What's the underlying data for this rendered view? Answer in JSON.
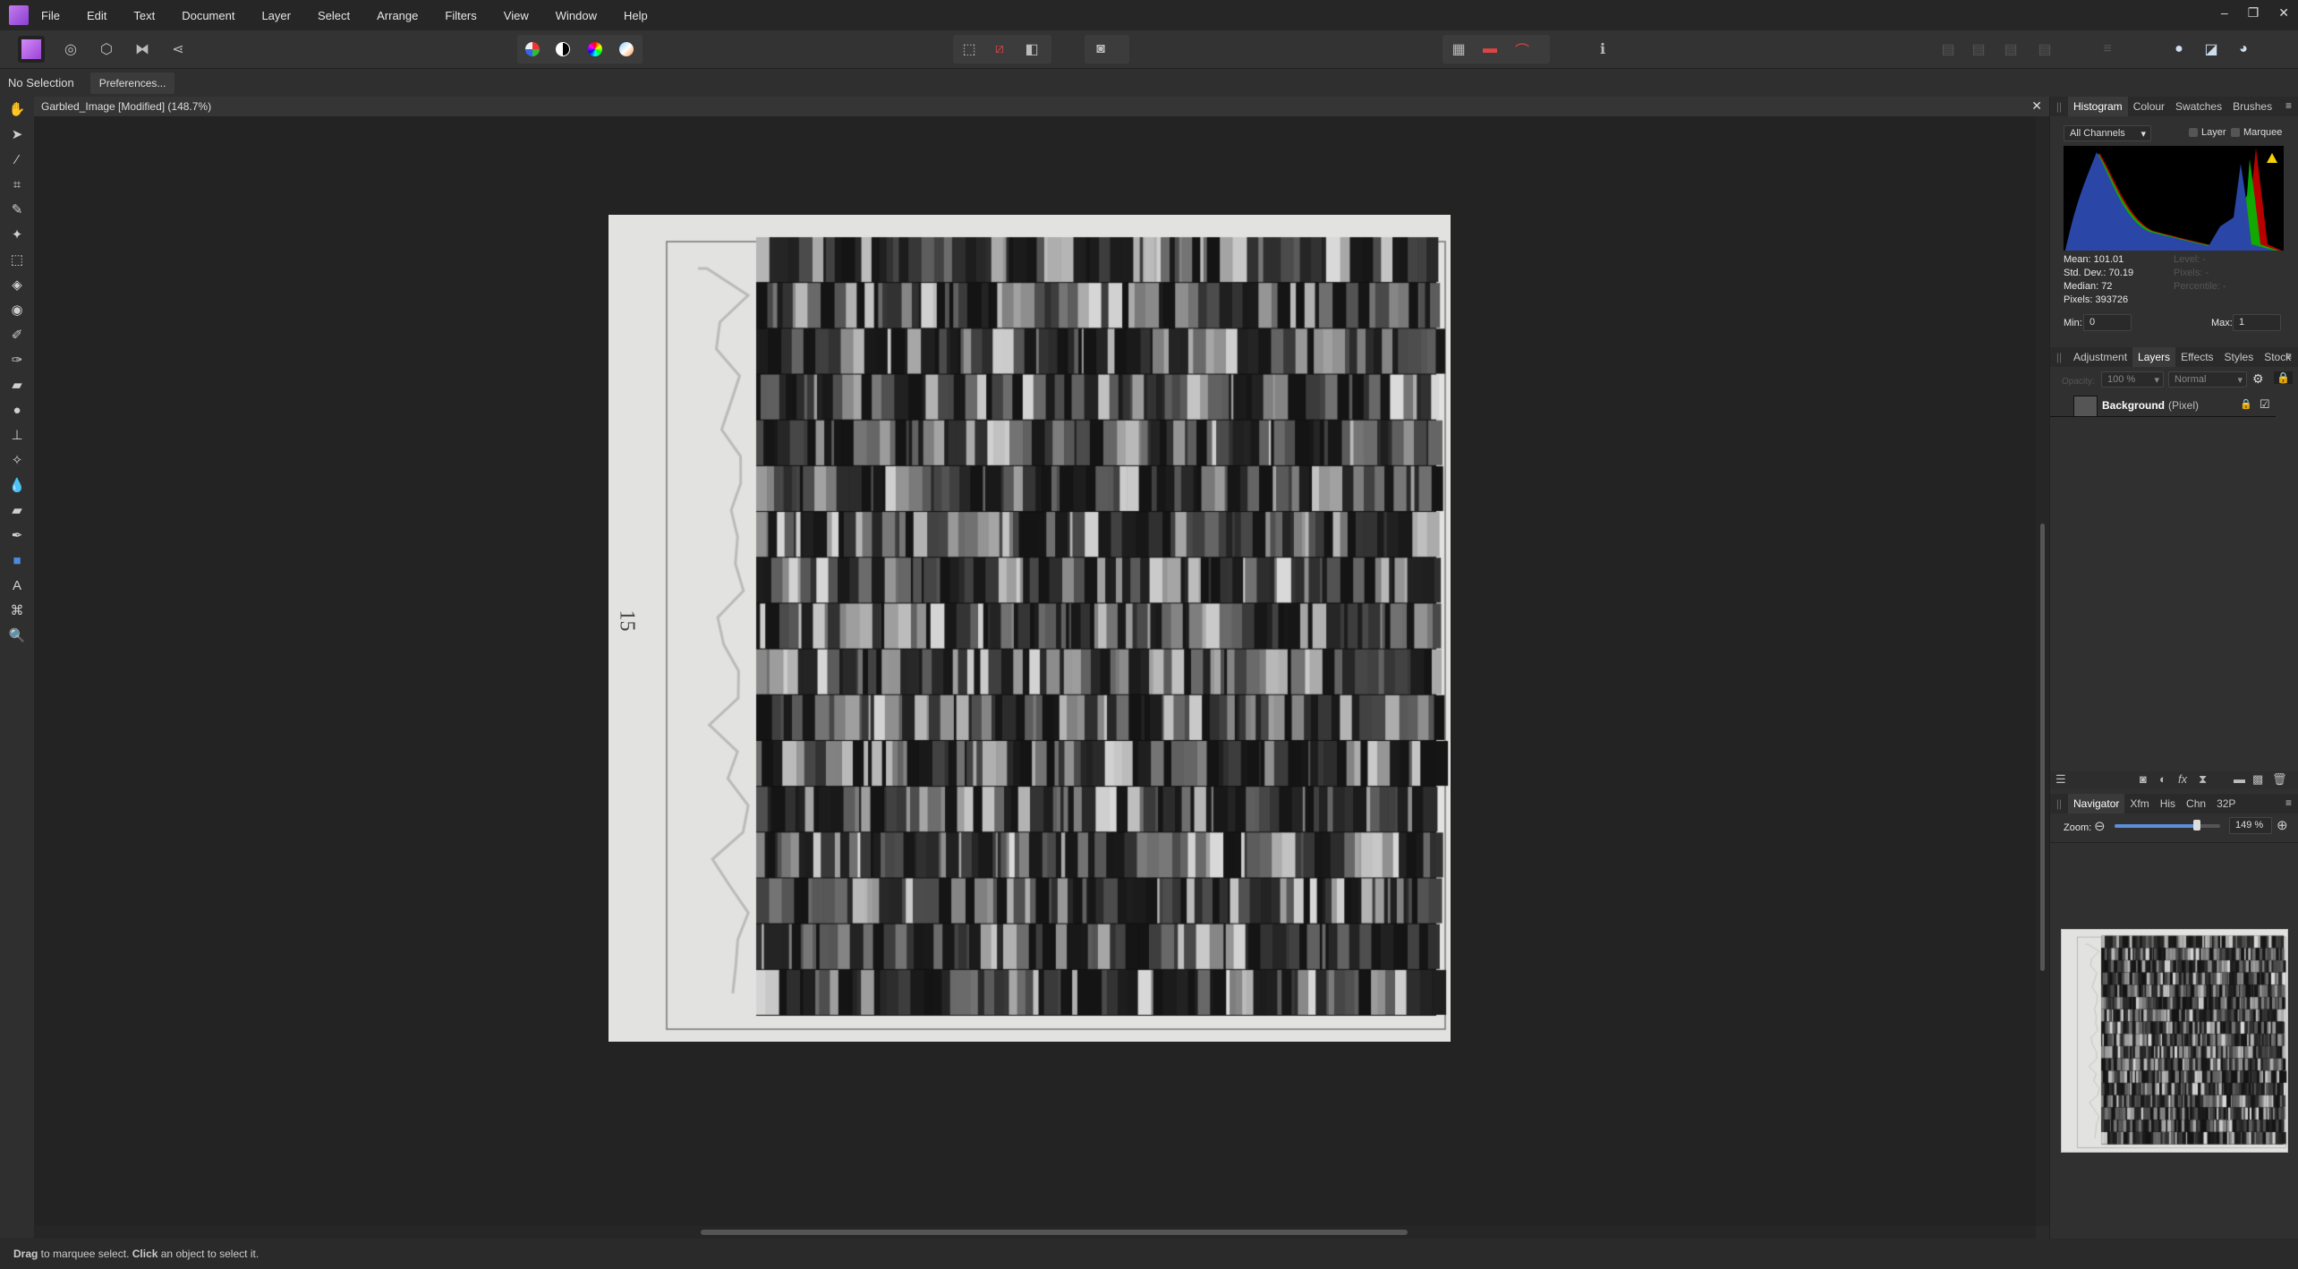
{
  "menu": {
    "items": [
      "File",
      "Edit",
      "Text",
      "Document",
      "Layer",
      "Select",
      "Arrange",
      "Filters",
      "View",
      "Window",
      "Help"
    ]
  },
  "window_controls": [
    "–",
    "❐",
    "✕"
  ],
  "context": {
    "selection": "No Selection",
    "preferences": "Preferences..."
  },
  "document": {
    "tab_title": "Garbled_Image [Modified] (148.7%)",
    "page_number": "15"
  },
  "histogram": {
    "tabs": [
      "Histogram",
      "Colour",
      "Swatches",
      "Brushes"
    ],
    "active_tab": "Histogram",
    "channel": "All Channels",
    "layer_label": "Layer",
    "marquee_label": "Marquee",
    "mean": "Mean: 101.01",
    "std": "Std. Dev.: 70.19",
    "median": "Median: 72",
    "pixels": "Pixels: 393726",
    "level": "Level: -",
    "pixels_hover": "Pixels: -",
    "percentile": "Percentile: -",
    "min_label": "Min:",
    "min": "0",
    "max_label": "Max:",
    "max": "1"
  },
  "layers": {
    "tabs": [
      "Adjustment",
      "Layers",
      "Effects",
      "Styles",
      "Stock"
    ],
    "active_tab": "Layers",
    "opacity_label": "Opacity:",
    "opacity": "100 %",
    "blend": "Normal",
    "layer_name": "Background",
    "layer_type": "(Pixel)"
  },
  "navigator": {
    "tabs": [
      "Navigator",
      "Xfm",
      "His",
      "Chn",
      "32P"
    ],
    "active_tab": "Navigator",
    "zoom_label": "Zoom:",
    "zoom": "149 %",
    "zoom_fraction": 0.78
  },
  "status": {
    "drag": "Drag",
    "t1": " to marquee select. ",
    "click": "Click",
    "t2": " an object to select it."
  },
  "colors": {
    "accent": "#5b8fd6",
    "brand": "#b45ae6"
  }
}
